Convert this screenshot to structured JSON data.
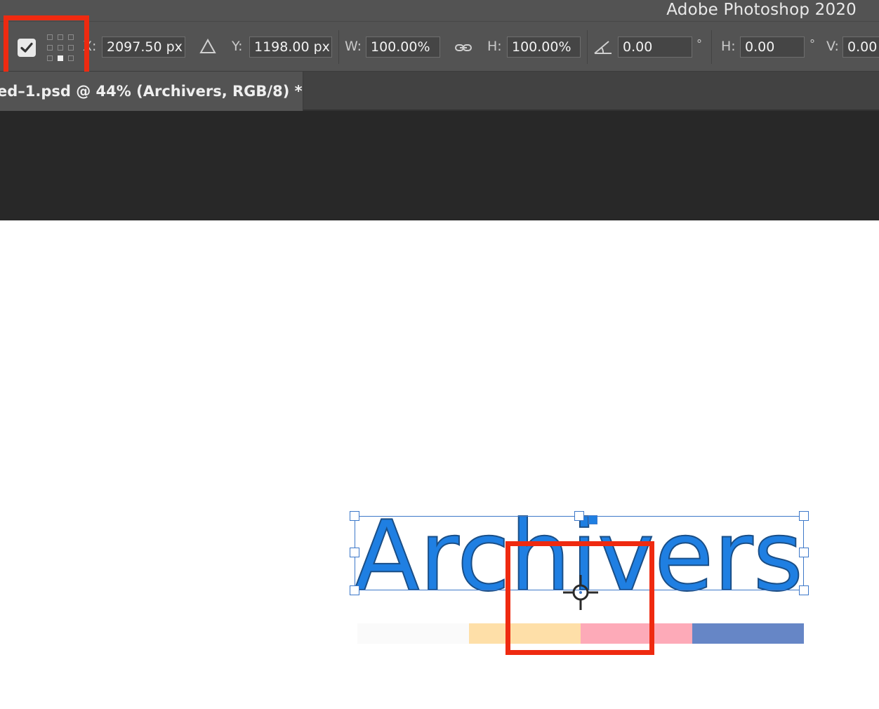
{
  "app": {
    "title": "Adobe Photoshop 2020"
  },
  "options_bar": {
    "show_transform_controls_checked": true,
    "x": {
      "label": "X:",
      "value": "2097.50 px"
    },
    "y": {
      "label": "Y:",
      "value": "1198.00 px"
    },
    "w": {
      "label": "W:",
      "value": "100.00%"
    },
    "h": {
      "label": "H:",
      "value": "100.00%"
    },
    "angle": {
      "value": "0.00",
      "unit": "°"
    },
    "skew_h": {
      "label": "H:",
      "value": "0.00",
      "unit": "°"
    },
    "skew_v": {
      "label": "V:",
      "value": "0.00"
    }
  },
  "document_tab": {
    "title": "ed–1.psd @ 44% (Archivers, RGB/8) *"
  },
  "canvas": {
    "text_layer": "Archivers",
    "palette_colors": [
      "#fafafa",
      "#fedfa8",
      "#fdaab8",
      "#6686c6"
    ]
  },
  "colors": {
    "text_fill": "#1f7fe2",
    "selection": "#3d78c9",
    "highlight": "#ef2a10",
    "app_bg": "#535353",
    "pasteboard": "#282828"
  },
  "icons": [
    "checkbox-icon",
    "reference-point-grid-icon",
    "delta-icon",
    "link-icon",
    "rotate-angle-icon",
    "reference-point-crosshair-icon"
  ]
}
